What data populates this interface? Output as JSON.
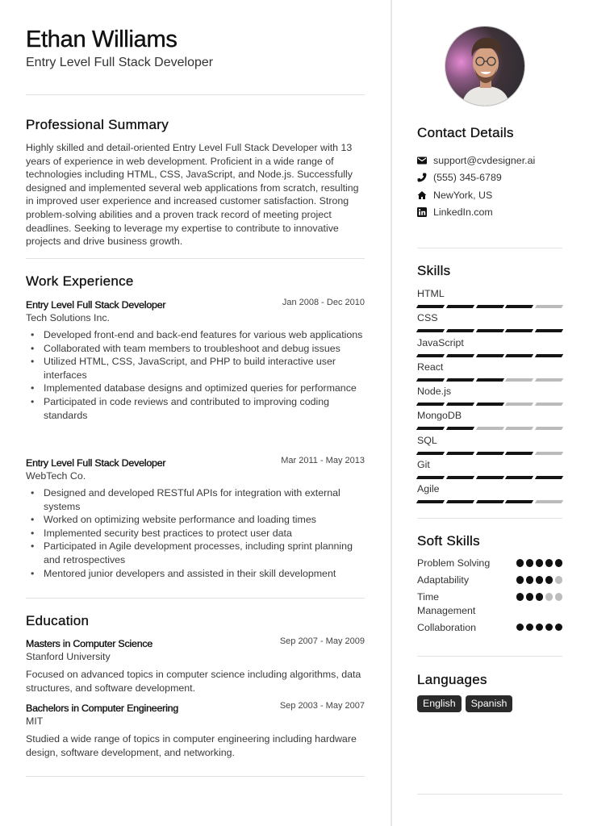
{
  "header": {
    "name": "Ethan Williams",
    "title": "Entry Level Full Stack Developer"
  },
  "summary": {
    "heading": "Professional Summary",
    "text": "Highly skilled and detail-oriented Entry Level Full Stack Developer with 13 years of experience in web development. Proficient in a wide range of technologies including HTML, CSS, JavaScript, and Node.js. Successfully designed and implemented several web applications from scratch, resulting in improved user experience and increased customer satisfaction. Strong problem-solving abilities and a proven track record of meeting project deadlines. Seeking to leverage my expertise to contribute to innovative projects and drive business growth."
  },
  "experience": {
    "heading": "Work Experience",
    "jobs": [
      {
        "title": "Entry Level Full Stack Developer",
        "date": "Jan 2008 - Dec 2010",
        "company": "Tech Solutions Inc.",
        "bullets": [
          "Developed front-end and back-end features for various web applications",
          "Collaborated with team members to troubleshoot and debug issues",
          "Utilized HTML, CSS, JavaScript, and PHP to build interactive user interfaces",
          "Implemented database designs and optimized queries for performance",
          "Participated in code reviews and contributed to improving coding standards"
        ]
      },
      {
        "title": "Entry Level Full Stack Developer",
        "date": "Mar 2011 - May 2013",
        "company": "WebTech Co.",
        "bullets": [
          "Designed and developed RESTful APIs for integration with external systems",
          "Worked on optimizing website performance and loading times",
          "Implemented security best practices to protect user data",
          "Participated in Agile development processes, including sprint planning and retrospectives",
          "Mentored junior developers and assisted in their skill development"
        ]
      }
    ]
  },
  "education": {
    "heading": "Education",
    "items": [
      {
        "degree": "Masters in Computer Science",
        "date": "Sep 2007 - May 2009",
        "school": "Stanford University",
        "description": "Focused on advanced topics in computer science including algorithms, data structures, and software development."
      },
      {
        "degree": "Bachelors in Computer Engineering",
        "date": "Sep 2003 - May 2007",
        "school": "MIT",
        "description": "Studied a wide range of topics in computer engineering including hardware design, software development, and networking."
      }
    ]
  },
  "contact": {
    "heading": "Contact Details",
    "items": [
      {
        "icon": "envelope-icon",
        "text": "support@cvdesigner.ai"
      },
      {
        "icon": "phone-icon",
        "text": "(555) 345-6789"
      },
      {
        "icon": "home-icon",
        "text": "NewYork, US"
      },
      {
        "icon": "linkedin-icon",
        "text": "LinkedIn.com"
      }
    ]
  },
  "skills": {
    "heading": "Skills",
    "max_level": 5,
    "items": [
      {
        "name": "HTML",
        "level": 4
      },
      {
        "name": "CSS",
        "level": 5
      },
      {
        "name": "JavaScript",
        "level": 5
      },
      {
        "name": "React",
        "level": 3
      },
      {
        "name": "Node.js",
        "level": 3
      },
      {
        "name": "MongoDB",
        "level": 2
      },
      {
        "name": "SQL",
        "level": 4
      },
      {
        "name": "Git",
        "level": 5
      },
      {
        "name": "Agile",
        "level": 4
      }
    ]
  },
  "soft_skills": {
    "heading": "Soft Skills",
    "max_level": 5,
    "items": [
      {
        "name": "Problem Solving",
        "level": 5
      },
      {
        "name": "Adaptability",
        "level": 4
      },
      {
        "name": "Time Management",
        "level": 3
      },
      {
        "name": "Collaboration",
        "level": 5
      }
    ]
  },
  "languages": {
    "heading": "Languages",
    "items": [
      "English",
      "Spanish"
    ]
  },
  "colors": {
    "filled": "#141414",
    "empty": "#bbbbbb",
    "divider": "#e2e2e2"
  }
}
